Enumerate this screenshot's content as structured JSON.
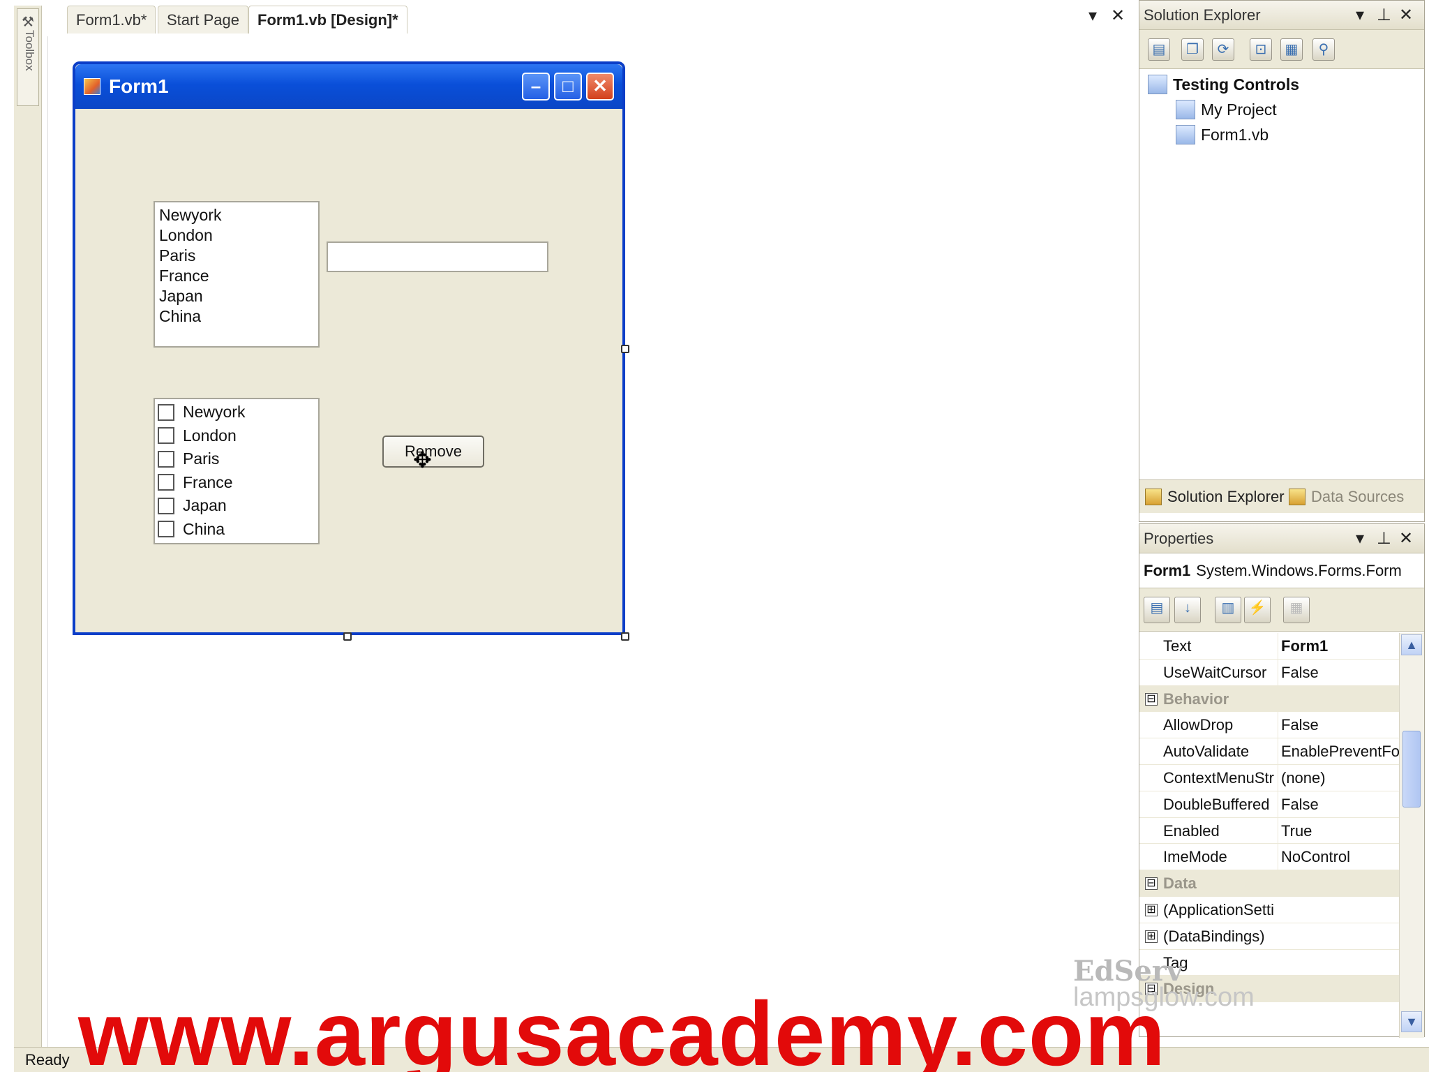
{
  "doc_tabs": [
    "Form1.vb*",
    "Start Page",
    "Form1.vb [Design]*"
  ],
  "toolbox": {
    "label": "Toolbox",
    "icon": "toolbox-icon"
  },
  "form": {
    "title": "Form1",
    "listbox_items": [
      "Newyork",
      "London",
      "Paris",
      "France",
      "Japan",
      "China"
    ],
    "textbox_value": "",
    "checklist_items": [
      "Newyork",
      "London",
      "Paris",
      "France",
      "Japan",
      "China"
    ],
    "button_label": "Remove"
  },
  "solution_explorer": {
    "title": "Solution Explorer",
    "project": "Testing Controls",
    "items": [
      "My Project",
      "Form1.vb"
    ],
    "tabs": [
      "Solution Explorer",
      "Data Sources"
    ]
  },
  "properties": {
    "title": "Properties",
    "object_name": "Form1",
    "object_type": "System.Windows.Forms.Form",
    "rows": [
      {
        "name": "Text",
        "value": "Form1",
        "kind": "prop",
        "bold": true
      },
      {
        "name": "UseWaitCursor",
        "value": "False",
        "kind": "prop"
      },
      {
        "name": "Behavior",
        "value": "",
        "kind": "cat",
        "expander": "⊟"
      },
      {
        "name": "AllowDrop",
        "value": "False",
        "kind": "prop"
      },
      {
        "name": "AutoValidate",
        "value": "EnablePreventFocusChange",
        "kind": "prop"
      },
      {
        "name": "ContextMenuStrip",
        "value": "(none)",
        "kind": "prop"
      },
      {
        "name": "DoubleBuffered",
        "value": "False",
        "kind": "prop"
      },
      {
        "name": "Enabled",
        "value": "True",
        "kind": "prop"
      },
      {
        "name": "ImeMode",
        "value": "NoControl",
        "kind": "prop"
      },
      {
        "name": "Data",
        "value": "",
        "kind": "cat",
        "expander": "⊟"
      },
      {
        "name": "(ApplicationSettings)",
        "value": "",
        "kind": "prop",
        "expander": "⊞"
      },
      {
        "name": "(DataBindings)",
        "value": "",
        "kind": "prop",
        "expander": "⊞"
      },
      {
        "name": "Tag",
        "value": "",
        "kind": "prop"
      },
      {
        "name": "Design",
        "value": "",
        "kind": "cat",
        "expander": "⊟"
      }
    ]
  },
  "status": "Ready",
  "watermarks": {
    "edserv": "EdServ",
    "lamp": "lampsglow.com",
    "argus": "www.argusacademy.com"
  },
  "colors": {
    "form_border": "#0b3ec8",
    "watermark_red": "#e20a0a"
  }
}
